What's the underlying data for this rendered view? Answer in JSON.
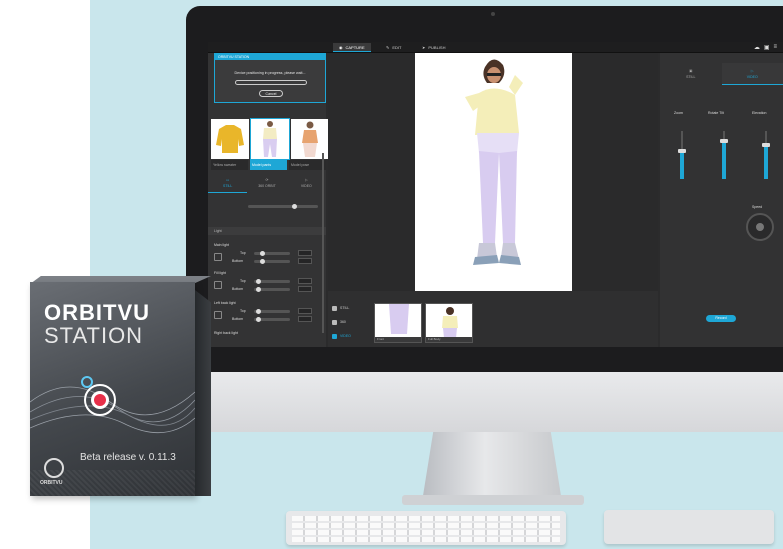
{
  "screen_app": {
    "tabs": [
      {
        "label": "CAPTURE"
      },
      {
        "label": "EDIT"
      },
      {
        "label": "PUBLISH"
      }
    ],
    "dialog": {
      "title": "ORBITVU STATION",
      "message": "Device positioning in progress, please wait...",
      "cancel_label": "Cancel"
    },
    "thumbnails": [
      {
        "label": "Yellow sweater"
      },
      {
        "label": "Model pants"
      },
      {
        "label": "Model pose"
      }
    ],
    "modes": [
      {
        "label": "STILL"
      },
      {
        "label": "360 ORBIT"
      },
      {
        "label": "VIDEO"
      }
    ],
    "sections": {
      "light": "Light",
      "light_groups": [
        "Main light",
        "Fill light",
        "Left back light",
        "Right back light"
      ],
      "top_label": "Top",
      "bottom_label": "Bottom"
    },
    "film": {
      "items": [
        {
          "label": "STILL"
        },
        {
          "label": "360"
        },
        {
          "label": "VIDEO"
        }
      ],
      "frames": [
        {
          "label": "Front"
        },
        {
          "label": "Full Body"
        }
      ]
    },
    "right_panel": {
      "tabs": [
        {
          "label": "STILL"
        },
        {
          "label": "VIDEO"
        }
      ],
      "columns": [
        "Zoom",
        "Rotate Tilt",
        "Elevation"
      ],
      "speed_label": "Speed",
      "record_label": "Record"
    }
  },
  "box": {
    "brand_line1": "ORBITVU",
    "brand_line2": "STATION",
    "release": "Beta release v. 0.11.3",
    "logo_text": "ORBITVU"
  },
  "colors": {
    "accent": "#1ea7d6",
    "background_panel": "#c9e6ec",
    "screen_bg": "#2b2b2c",
    "box_dark": "#3c4045"
  }
}
